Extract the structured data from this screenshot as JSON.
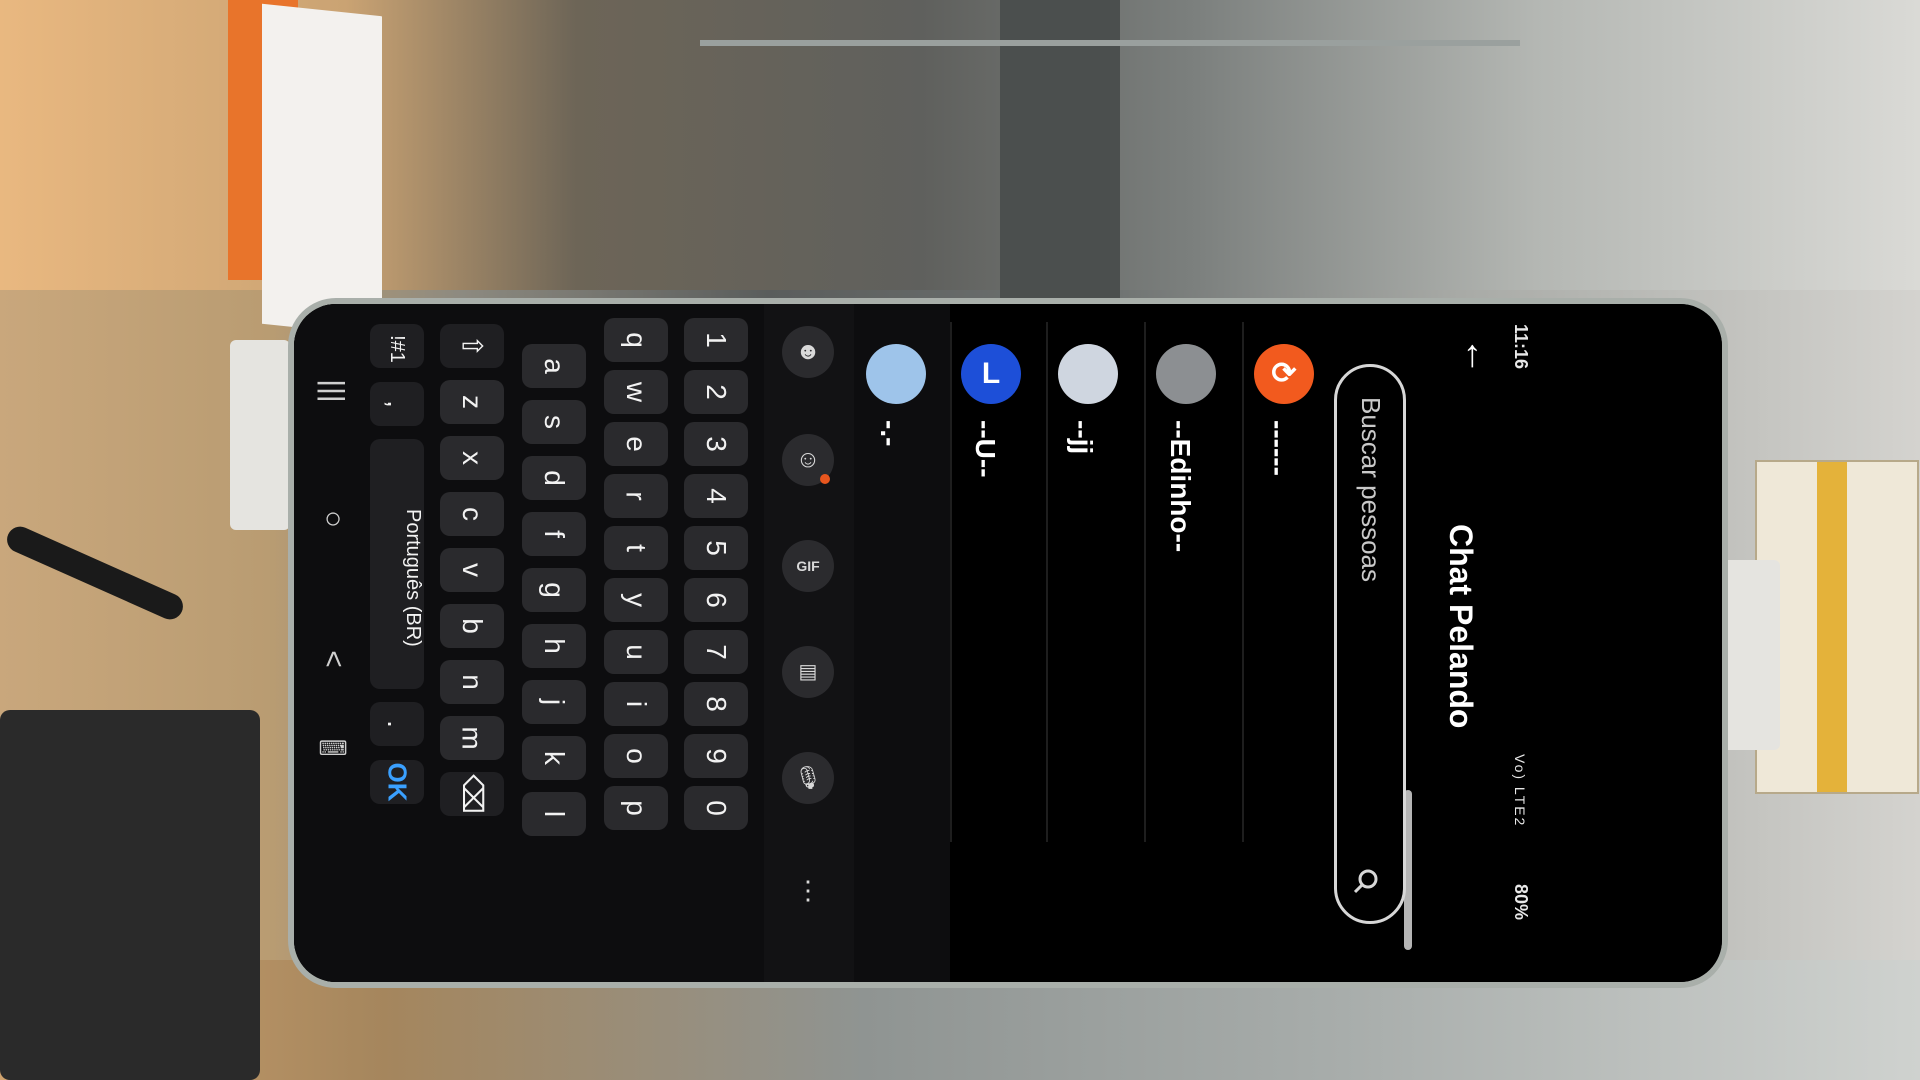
{
  "app": {
    "title": "Chat Pelando",
    "back_icon": "arrow-left-icon"
  },
  "status_bar": {
    "time": "11:16",
    "battery": "80%",
    "signal": "Vo) LTE2"
  },
  "search": {
    "placeholder": "Buscar pessoas",
    "icon": "search-icon"
  },
  "contacts": [
    {
      "name": "------",
      "avatar_letter": "",
      "avatar_color": "#f25a1e"
    },
    {
      "name": "--Edinho--",
      "avatar_letter": "",
      "avatar_color": "#8c8f92"
    },
    {
      "name": "--jj",
      "avatar_letter": "",
      "avatar_color": "#cfd6e0"
    },
    {
      "name": "--U--",
      "avatar_letter": "L",
      "avatar_color": "#1d4fd8"
    },
    {
      "name": "-.-",
      "avatar_letter": "",
      "avatar_color": "#9ec4ea"
    }
  ],
  "keyboard": {
    "toolbar": [
      "sticker-icon",
      "emoji-icon",
      "gif-icon",
      "clipboard-icon",
      "microphone-icon",
      "more-icon"
    ],
    "number_row": [
      "1",
      "2",
      "3",
      "4",
      "5",
      "6",
      "7",
      "8",
      "9",
      "0"
    ],
    "row1": [
      "q",
      "w",
      "e",
      "r",
      "t",
      "y",
      "u",
      "i",
      "o",
      "p"
    ],
    "row2": [
      "a",
      "s",
      "d",
      "f",
      "g",
      "h",
      "j",
      "k",
      "l"
    ],
    "row3": [
      "z",
      "x",
      "c",
      "v",
      "b",
      "n",
      "m"
    ],
    "symbols_key": "!#1",
    "comma_key": ",",
    "period_key": ".",
    "space_label": "Português (BR)",
    "enter_label": "OK"
  },
  "nav_bar": {
    "recents": "|||",
    "home": "○",
    "back": "<"
  }
}
